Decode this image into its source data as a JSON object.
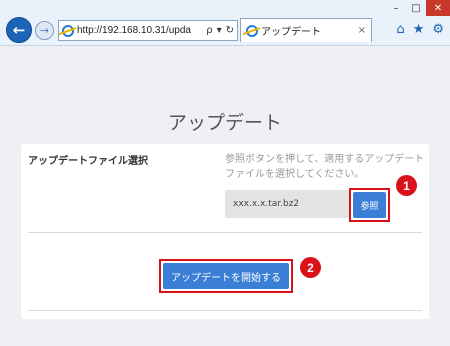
{
  "browser": {
    "url": "http://192.168.10.31/upda",
    "tab_title": "アップデート",
    "window_controls": {
      "minimize": "–",
      "maximize": "□",
      "close": "✕"
    },
    "icons": {
      "back": "←",
      "forward": "→",
      "search": "ρ",
      "dropdown": "▾",
      "refresh": "↻",
      "tab_close": "×",
      "home": "⌂",
      "favorites": "★",
      "settings": "⚙"
    }
  },
  "page": {
    "title": "アップデート",
    "section_label": "アップデートファイル選択",
    "help_text": "参照ボタンを押して、適用するアップデートファイルを選択してください。",
    "file_value": "xxx.x.x.tar.bz2",
    "browse_label": "参照",
    "start_label": "アップデートを開始する"
  },
  "markers": {
    "one": "1",
    "two": "2"
  },
  "colors": {
    "accent": "#3a7ed6",
    "highlight": "#d9121a",
    "background": "#eef0f5"
  }
}
